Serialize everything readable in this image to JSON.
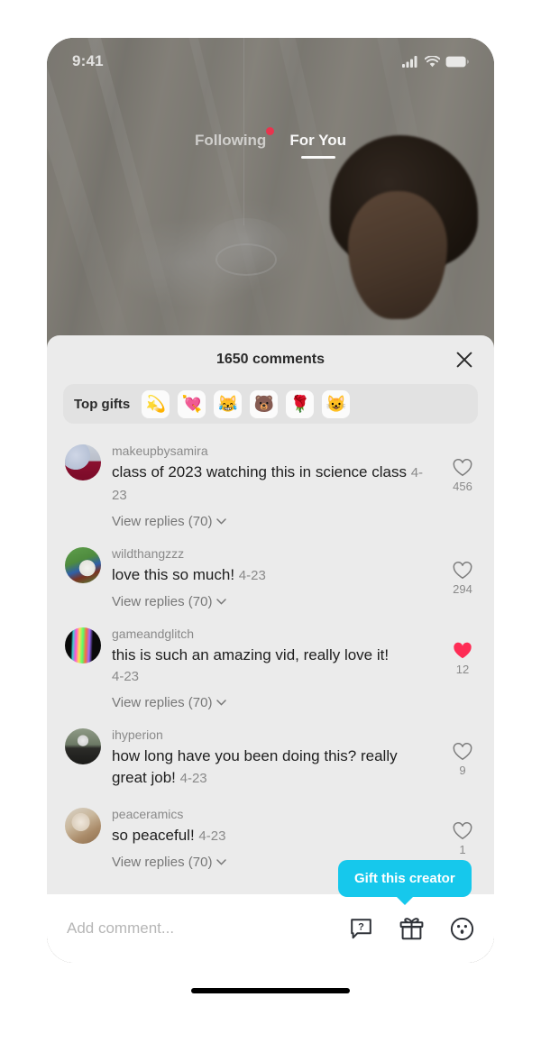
{
  "status_bar": {
    "time": "9:41",
    "cellular_icon": "signal-bars-icon",
    "wifi_icon": "wifi-icon",
    "battery_icon": "battery-icon"
  },
  "top_tabs": {
    "following": "Following",
    "for_you": "For You",
    "active": "For You",
    "notification_dot_color": "#e8344e"
  },
  "sheet": {
    "comment_count_label": "1650 comments",
    "close_icon": "close-icon"
  },
  "top_gifts": {
    "label": "Top gifts",
    "items": [
      {
        "name": "gift-chip-star-burst",
        "emoji": "💫"
      },
      {
        "name": "gift-chip-heart-arrow",
        "emoji": "💘"
      },
      {
        "name": "gift-chip-joy-face",
        "emoji": "😹"
      },
      {
        "name": "gift-chip-bear",
        "emoji": "🐻"
      },
      {
        "name": "gift-chip-rose",
        "emoji": "🌹"
      },
      {
        "name": "gift-chip-cat-face",
        "emoji": "😺"
      }
    ]
  },
  "comments": [
    {
      "username": "makeupbysamira",
      "text": "class of 2023 watching this in science class",
      "date": "4-23",
      "replies_label": "View replies (70)",
      "has_replies": true,
      "likes": "456",
      "liked": false,
      "avatar_class": "av-a"
    },
    {
      "username": "wildthangzzz",
      "text": "love this so much!",
      "date": "4-23",
      "replies_label": "View replies (70)",
      "has_replies": true,
      "likes": "294",
      "liked": false,
      "avatar_class": "av-b"
    },
    {
      "username": "gameandglitch",
      "text": "this is such an amazing vid, really love it!",
      "date": "4-23",
      "replies_label": "View replies (70)",
      "has_replies": true,
      "likes": "12",
      "liked": true,
      "avatar_class": "av-c"
    },
    {
      "username": "ihyperion",
      "text": "how long have you been doing this? really great job!",
      "date": "4-23",
      "replies_label": "",
      "has_replies": false,
      "likes": "9",
      "liked": false,
      "avatar_class": "av-d"
    },
    {
      "username": "peaceramics",
      "text": "so peaceful!",
      "date": "4-23",
      "replies_label": "View replies (70)",
      "has_replies": true,
      "likes": "1",
      "liked": false,
      "avatar_class": "av-e"
    }
  ],
  "composer": {
    "placeholder": "Add comment...",
    "value": "",
    "icons": [
      {
        "name": "question-bubble-icon"
      },
      {
        "name": "gift-icon"
      },
      {
        "name": "emoji-face-icon"
      }
    ]
  },
  "tooltip": {
    "text": "Gift this creator",
    "color": "#16c8ec"
  },
  "colors": {
    "sheet_background": "#ebebeb",
    "composer_background": "#ffffff",
    "liked_heart": "#fe2c55",
    "accent_cyan": "#16c8ec"
  }
}
